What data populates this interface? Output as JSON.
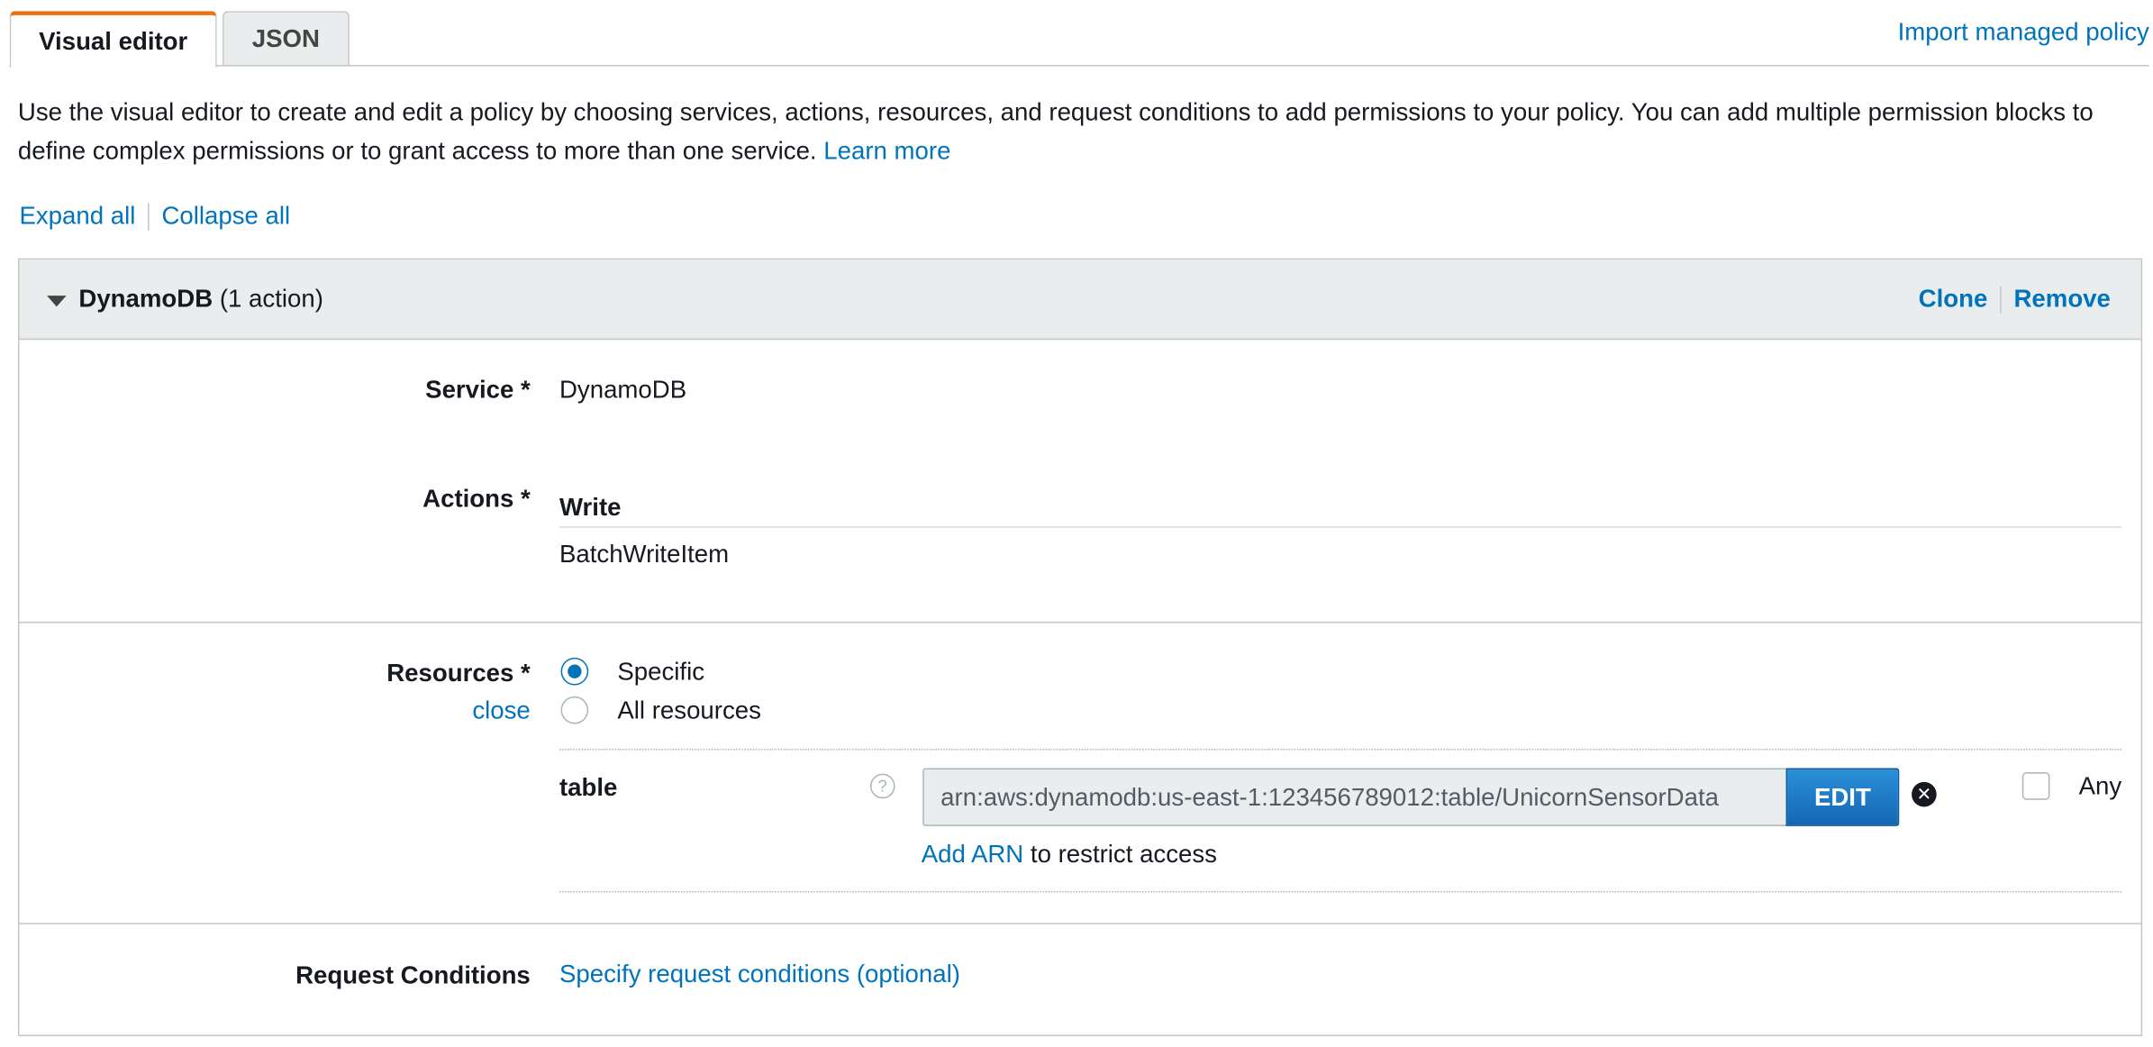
{
  "tabs": [
    {
      "label": "Visual editor",
      "active": true
    },
    {
      "label": "JSON",
      "active": false
    }
  ],
  "import_link": "Import managed policy",
  "description": {
    "text": "Use the visual editor to create and edit a policy by choosing services, actions, resources, and request conditions to add permissions to your policy. You can add multiple permission blocks to define complex permissions or to grant access to more than one service.",
    "learn_more": "Learn more"
  },
  "expand_all": "Expand all",
  "collapse_all": "Collapse all",
  "block": {
    "service_name": "DynamoDB",
    "action_count": "(1 action)",
    "clone": "Clone",
    "remove": "Remove",
    "service_label": "Service *",
    "service_value": "DynamoDB",
    "actions_label": "Actions *",
    "actions_group": "Write",
    "actions_item": "BatchWriteItem",
    "resources_label": "Resources *",
    "resources_close": "close",
    "radio_specific": "Specific",
    "radio_all": "All resources",
    "resource_type": "table",
    "help_glyph": "?",
    "arn_value": "arn:aws:dynamodb:us-east-1:123456789012:table/UnicornSensorData",
    "edit_button": "EDIT",
    "remove_glyph": "✕",
    "any_label": "Any",
    "add_arn": "Add ARN",
    "add_arn_suffix": " to restrict access",
    "conditions_label": "Request Conditions",
    "conditions_link": "Specify request conditions (optional)"
  },
  "colors": {
    "accent_tab": "#ec7211",
    "link": "#0073bb",
    "edit_button": "#1a73c4"
  }
}
